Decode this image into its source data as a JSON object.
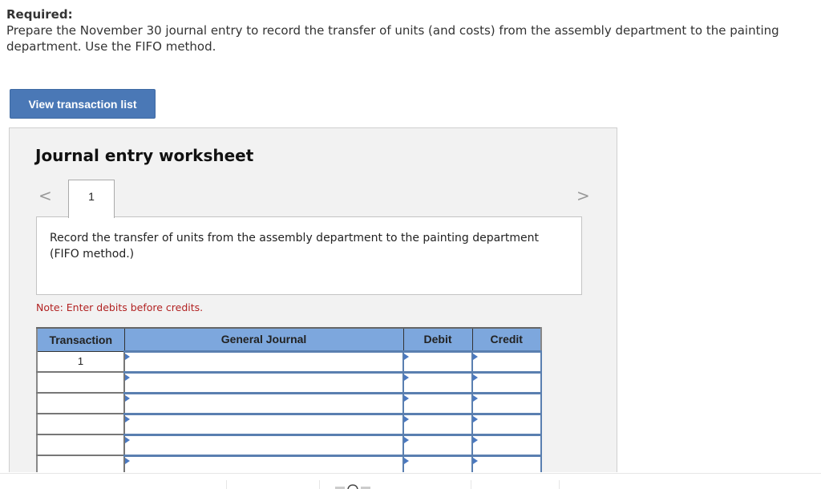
{
  "required": {
    "label": "Required:",
    "text": "Prepare the November 30 journal entry to record the transfer of units (and costs) from the assembly department to the painting department. Use the FIFO method."
  },
  "buttons": {
    "view_transaction_list": "View transaction list"
  },
  "worksheet": {
    "title": "Journal entry worksheet",
    "nav": {
      "prev_icon": "chevron-left-icon",
      "next_icon": "chevron-right-icon",
      "prev_glyph": "<",
      "next_glyph": ">"
    },
    "tabs": [
      {
        "label": "1",
        "active": true
      }
    ],
    "description": "Record the transfer of units from the assembly department to the painting department (FIFO method.)",
    "note": "Note: Enter debits before credits.",
    "table": {
      "columns": [
        "Transaction",
        "General Journal",
        "Debit",
        "Credit"
      ],
      "rows": [
        {
          "transaction": "1",
          "account": "",
          "debit": "",
          "credit": ""
        },
        {
          "transaction": "",
          "account": "",
          "debit": "",
          "credit": ""
        },
        {
          "transaction": "",
          "account": "",
          "debit": "",
          "credit": ""
        },
        {
          "transaction": "",
          "account": "",
          "debit": "",
          "credit": ""
        },
        {
          "transaction": "",
          "account": "",
          "debit": "",
          "credit": ""
        },
        {
          "transaction": "",
          "account": "",
          "debit": "",
          "credit": ""
        }
      ]
    }
  },
  "colors": {
    "button_blue": "#4a78b6",
    "header_blue": "#7da7dd",
    "note_red": "#b22222",
    "panel_gray": "#f2f2f2"
  }
}
